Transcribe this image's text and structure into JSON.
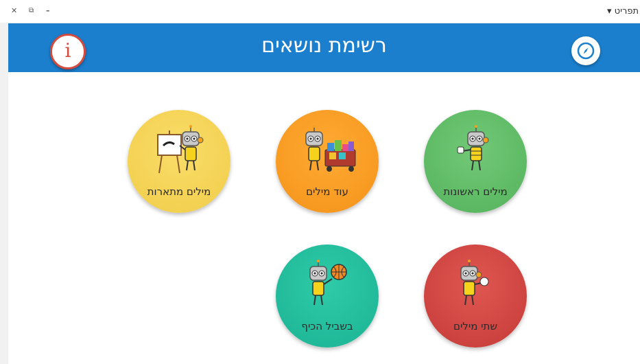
{
  "window": {
    "close_glyph": "✕",
    "restore_glyph": "⧉",
    "minimize_glyph": "–",
    "menu_label": "תפריט ▾"
  },
  "header": {
    "title": "רשימת נושאים",
    "info_glyph": "i"
  },
  "topics": [
    {
      "label": "מילים ראשונות",
      "color": "#5cb963",
      "icon": "robot-thumbs-up"
    },
    {
      "label": "עוד מילים",
      "color": "#f89c22",
      "icon": "robot-with-cart"
    },
    {
      "label": "מילים מתארות",
      "color": "#f4d354",
      "icon": "robot-painting"
    },
    {
      "label": "שתי מילים",
      "color": "#d3453f",
      "icon": "robot-waving"
    },
    {
      "label": "בשביל הכיף",
      "color": "#22bf9d",
      "icon": "robot-basketball"
    }
  ]
}
